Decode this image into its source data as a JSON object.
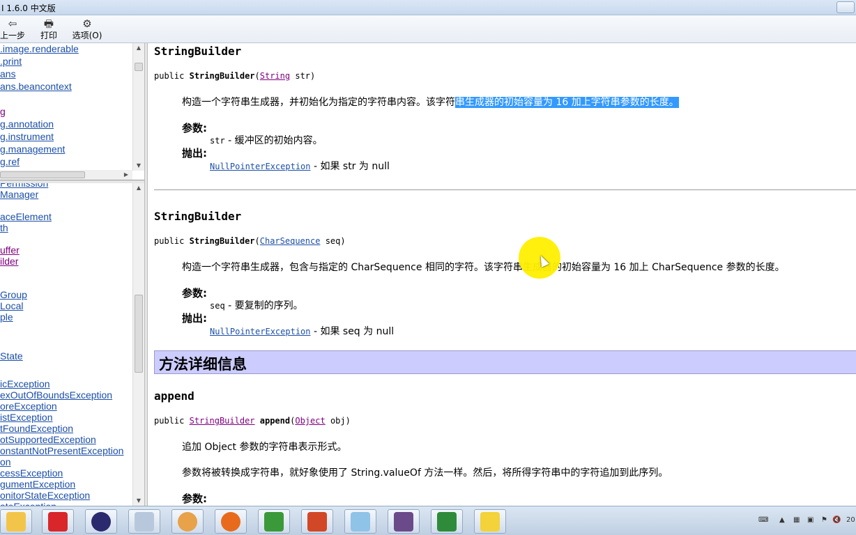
{
  "window": {
    "title": "I 1.6.0 中文版"
  },
  "toolbar": {
    "back_label": "上一步",
    "print_label": "打印",
    "options_label": "选项(O)"
  },
  "packages": [
    ".image.renderable",
    ".print",
    "ans",
    "ans.beancontext",
    "g",
    "g.annotation",
    "g.instrument",
    "g.management",
    "g.ref"
  ],
  "classes": [
    "Permission",
    "Manager",
    "aceElement",
    "th",
    "uffer",
    "ilder",
    "Group",
    "Local",
    "ple",
    "State",
    "icException",
    "exOutOfBoundsException",
    "oreException",
    "istException",
    "tFoundException",
    "otSupportedException",
    "onstantNotPresentException",
    "on",
    "cessException",
    "gumentException",
    "onitorStateException",
    "ateException"
  ],
  "content": {
    "ctor1": {
      "title": "StringBuilder",
      "sig_public": "public",
      "sig_name": "StringBuilder",
      "sig_type": "String",
      "sig_param": "str)",
      "desc_plain": "构造一个字符串生成器，并初始化为指定的字符串内容。该字符",
      "desc_highlight": "串生成器的初始容量为 16 加上字符串参数的长度。",
      "params_label": "参数:",
      "param_name": "str",
      "param_desc": " - 缓冲区的初始内容。",
      "throws_label": "抛出:",
      "throws_type": "NullPointerException",
      "throws_desc": " - 如果 str 为 null"
    },
    "ctor2": {
      "title": "StringBuilder",
      "sig_public": "public",
      "sig_name": "StringBuilder",
      "sig_type": "CharSequence",
      "sig_param": "seq)",
      "desc": "构造一个字符串生成器，包含与指定的 CharSequence 相同的字符。该字符串生成器的初始容量为 16 加上 CharSequence 参数的长度。",
      "params_label": "参数:",
      "param_name": "seq",
      "param_desc": " - 要复制的序列。",
      "throws_label": "抛出:",
      "throws_type": "NullPointerException",
      "throws_desc": " - 如果 seq 为 null"
    },
    "section_title": "方法详细信息",
    "method": {
      "title": "append",
      "sig_public": "public",
      "sig_return": "StringBuilder",
      "sig_name": "append",
      "sig_type": "Object",
      "sig_param": "obj)",
      "desc1": "追加 Object 参数的字符串表示形式。",
      "desc2": "参数将被转换成字符串，就好象使用了 String.valueOf 方法一样。然后，将所得字符串中的字符追加到此序列。",
      "params_label": "参数:"
    }
  },
  "taskbar": {
    "apps": [
      "file-explorer-icon",
      "adobe-icon",
      "eclipse-icon",
      "calculator-icon",
      "paint-icon",
      "firefox-icon",
      "chart-icon",
      "powerpoint-icon",
      "notepad-icon",
      "javaee-ide-icon",
      "remote-icon",
      "help-icon"
    ],
    "clock": "20"
  },
  "colors": {
    "link": "#1b4fa8",
    "visited": "#800080",
    "section_bg": "#ccccff",
    "highlight": "#3399ff"
  }
}
